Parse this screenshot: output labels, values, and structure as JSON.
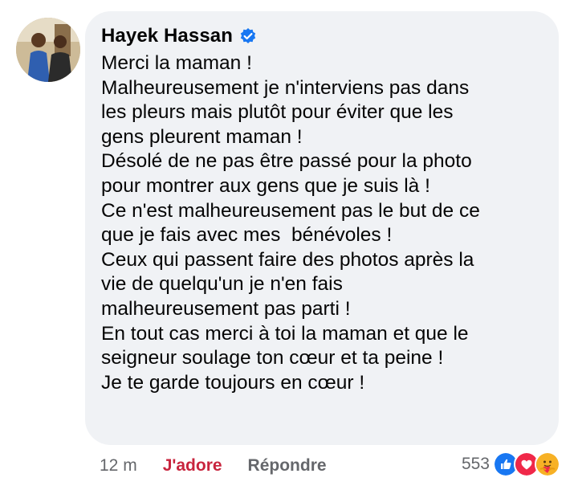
{
  "comment": {
    "author": "Hayek Hassan",
    "lines": [
      "Merci la maman !",
      "Malheureusement je n'interviens pas dans",
      "les pleurs mais plutôt pour éviter que les",
      "gens pleurent maman !",
      "Désolé de ne pas être passé pour la photo",
      "pour montrer aux gens que je suis là !",
      "Ce n'est malheureusement pas le but de ce",
      "que je fais avec mes  bénévoles !",
      "Ceux qui passent faire des photos après la",
      "vie de quelqu'un je n'en fais",
      "malheureusement pas parti !",
      "En tout cas merci à toi la maman et que le",
      "seigneur soulage ton cœur et ta peine !",
      "Je te garde toujours en cœur !"
    ]
  },
  "actions": {
    "time": "12 m",
    "love_label": "J'adore",
    "reply_label": "Répondre"
  },
  "reactions": {
    "count": "553",
    "icons": [
      "like-icon",
      "love-icon",
      "care-icon"
    ]
  },
  "colors": {
    "bubble": "#f0f2f5",
    "love_action": "#c8243d",
    "secondary_text": "#65676b",
    "verified": "#1877f2"
  }
}
